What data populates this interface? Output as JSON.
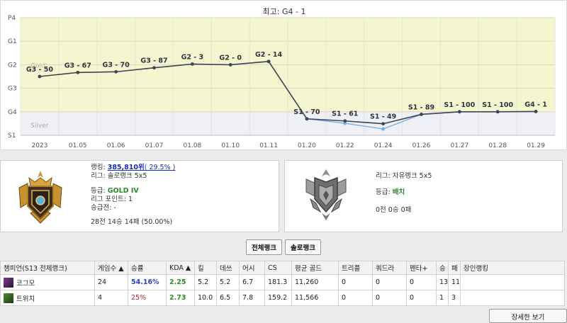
{
  "chart_data": {
    "type": "line",
    "title": "최고: G4 - 1",
    "y_tick_labels": [
      "P4",
      "G1",
      "G2",
      "G3",
      "G4",
      "S1"
    ],
    "band_labels": [
      "Gold",
      "Silver"
    ],
    "x": [
      "2023",
      "01.05",
      "01.06",
      "01.07",
      "01.08",
      "01.10",
      "01.11",
      "01.20",
      "01.22",
      "01.24",
      "01.26",
      "01.27",
      "01.28",
      "01.29"
    ],
    "series": [
      {
        "values": [
          3.5,
          3.67,
          3.7,
          3.87,
          4.03,
          4.0,
          4.14,
          1.7,
          1.61,
          1.49,
          1.89,
          2.0,
          2.0,
          2.01
        ],
        "point_labels": [
          "G3 - 50",
          "G3 - 67",
          "G3 - 70",
          "G3 - 87",
          "G2 - 3",
          "G2 - 0",
          "G2 - 14",
          "S1 - 70",
          "S1 - 61",
          "S1 - 49",
          "S1 - 89",
          "S1 - 100",
          "S1 - 100",
          "G4 - 1"
        ],
        "color": "#3d4654"
      },
      {
        "values": [
          null,
          null,
          null,
          null,
          null,
          4.0,
          4.14,
          1.7,
          1.51,
          1.27,
          1.89,
          2.0,
          2.0,
          2.01
        ],
        "color": "#7aaee3"
      }
    ],
    "ylim": [
      1,
      6
    ],
    "grid": true,
    "band_colors": {
      "gold": "#f5f5cf",
      "silver": "#efeff6"
    }
  },
  "solo": {
    "ranking_label": "랭킹: ",
    "ranking_value": "385,810위",
    "ranking_pct": "( 29.5% )",
    "league": "리그: 솔로랭크 5x5",
    "tier_label": "등급: ",
    "tier_value": "GOLD IV",
    "points": "리그 포인트: 1",
    "promo": "승급전: -",
    "record": "28전 14승 14패 (50.00%)"
  },
  "flex": {
    "league": "리그: 자유랭크 5x5",
    "tier_label": "등급: ",
    "tier_value": "배치",
    "record": "0전 0승 0패"
  },
  "tabs": [
    "전체랭크",
    "솔로랭크"
  ],
  "table": {
    "headers": [
      "챔피언(S13 전체랭크)",
      "게임수 ▲",
      "승률",
      "KDA ▲",
      "킬",
      "데쓰",
      "어시",
      "CS",
      "평균 골드",
      "트리플",
      "쿼드라",
      "펜타+",
      "승",
      "패",
      "장인랭킹"
    ],
    "rows": [
      {
        "champ": "코그모",
        "games": "24",
        "winrate": "54.16%",
        "kda": "2.25",
        "kills": "5.2",
        "deaths": "5.2",
        "assists": "6.7",
        "cs": "181.3",
        "gold": "11,260",
        "triple": "0",
        "quadra": "0",
        "penta": "0",
        "wins": "13",
        "losses": "11",
        "master": "",
        "icon_color": "#5a2a6a"
      },
      {
        "champ": "트위치",
        "games": "4",
        "winrate": "25%",
        "kda": "2.73",
        "kills": "10.0",
        "deaths": "6.5",
        "assists": "7.8",
        "cs": "159.2",
        "gold": "11,566",
        "triple": "0",
        "quadra": "0",
        "penta": "0",
        "wins": "1",
        "losses": "3",
        "master": "",
        "icon_color": "#3a6a2a"
      }
    ]
  },
  "detail_button": "장세한 보기"
}
